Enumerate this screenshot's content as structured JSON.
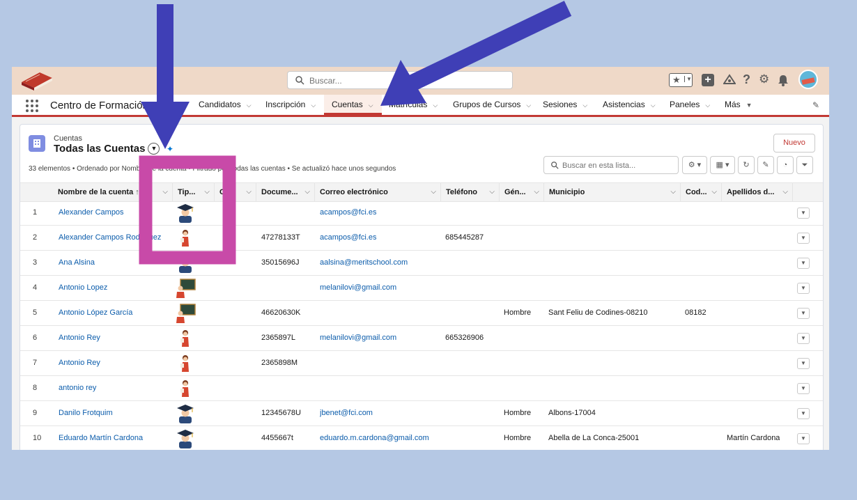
{
  "header": {
    "search_placeholder": "Buscar...",
    "icons": [
      "favorites-star-icon",
      "add-icon",
      "trailhead-icon",
      "help-icon",
      "setup-gear-icon",
      "notifications-bell-icon",
      "user-avatar"
    ]
  },
  "nav": {
    "app_name": "Centro de Formación",
    "items": [
      {
        "label": "Candidatos"
      },
      {
        "label": "Inscripción"
      },
      {
        "label": "Cuentas",
        "active": true
      },
      {
        "label": "Matrículas"
      },
      {
        "label": "Grupos de Cursos"
      },
      {
        "label": "Sesiones"
      },
      {
        "label": "Asistencias"
      },
      {
        "label": "Paneles"
      },
      {
        "label": "Más"
      }
    ]
  },
  "list": {
    "object": "Cuentas",
    "view": "Todas las Cuentas",
    "meta": "33 elementos • Ordenado por Nombre de la cuenta • Filtrado por Todas las cuentas • Se actualizó hace unos segundos",
    "new_button": "Nuevo",
    "search_placeholder": "Buscar en esta lista...",
    "columns": [
      "Nombre de la cuenta",
      "Tip...",
      "CIF",
      "Docume...",
      "Correo electrónico",
      "Teléfono",
      "Gén...",
      "Municipio",
      "Cod...",
      "Apellidos d..."
    ],
    "rows": [
      {
        "n": "1",
        "name": "Alexander Campos",
        "type": "student",
        "doc": "",
        "email": "acampos@fci.es",
        "phone": "",
        "gender": "",
        "city": "",
        "cod": "",
        "surname": ""
      },
      {
        "n": "2",
        "name": "Alexander Campos Rodríguez",
        "type": "teacher",
        "doc": "47278133T",
        "email": "acampos@fci.es",
        "phone": "685445287",
        "gender": "",
        "city": "",
        "cod": "",
        "surname": ""
      },
      {
        "n": "3",
        "name": "Ana Alsina",
        "type": "student",
        "doc": "35015696J",
        "email": "aalsina@meritschool.com",
        "phone": "",
        "gender": "",
        "city": "",
        "cod": "",
        "surname": ""
      },
      {
        "n": "4",
        "name": "Antonio Lopez",
        "type": "board",
        "doc": "",
        "email": "melanilovi@gmail.com",
        "phone": "",
        "gender": "",
        "city": "",
        "cod": "",
        "surname": ""
      },
      {
        "n": "5",
        "name": "Antonio López García",
        "type": "board",
        "doc": "46620630K",
        "email": "",
        "phone": "",
        "gender": "Hombre",
        "city": "Sant Feliu de Codines-08210",
        "cod": "08182",
        "surname": ""
      },
      {
        "n": "6",
        "name": "Antonio Rey",
        "type": "teacher",
        "doc": "2365897L",
        "email": "melanilovi@gmail.com",
        "phone": "665326906",
        "gender": "",
        "city": "",
        "cod": "",
        "surname": ""
      },
      {
        "n": "7",
        "name": "Antonio Rey",
        "type": "teacher",
        "doc": "2365898M",
        "email": "",
        "phone": "",
        "gender": "",
        "city": "",
        "cod": "",
        "surname": ""
      },
      {
        "n": "8",
        "name": "antonio rey",
        "type": "teacher",
        "doc": "",
        "email": "",
        "phone": "",
        "gender": "",
        "city": "",
        "cod": "",
        "surname": ""
      },
      {
        "n": "9",
        "name": "Danilo Frotquim",
        "type": "student",
        "doc": "12345678U",
        "email": "jbenet@fci.com",
        "phone": "",
        "gender": "Hombre",
        "city": "Albons-17004",
        "cod": "",
        "surname": ""
      },
      {
        "n": "10",
        "name": "Eduardo Martín Cardona",
        "type": "student",
        "doc": "4455667t",
        "email": "eduardo.m.cardona@gmail.com",
        "phone": "",
        "gender": "Hombre",
        "city": "Abella de La Conca-25001",
        "cod": "",
        "surname": "Martín Cardona"
      }
    ]
  },
  "annotations": {
    "arrow_color": "#3f3fb6",
    "highlight_color": "#c84aa8"
  }
}
